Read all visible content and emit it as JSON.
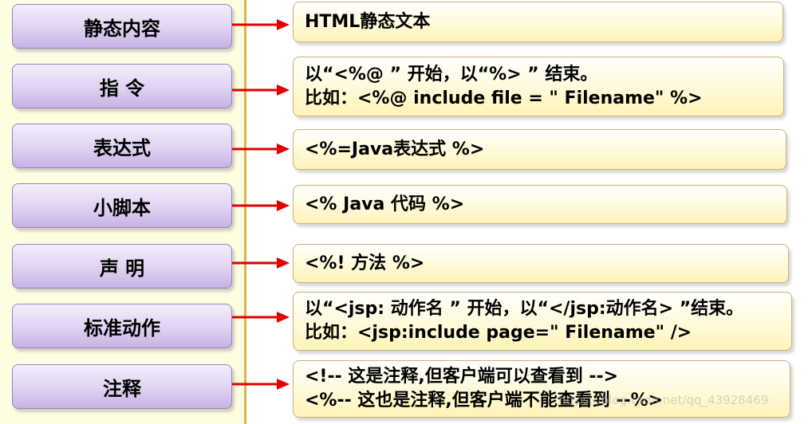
{
  "rows": [
    {
      "label": "静态内容",
      "lines": [
        "HTML静态文本"
      ]
    },
    {
      "label": "指 令",
      "lines": [
        "以“<%@ ” 开始，以“%> ” 结束。",
        "比如：<%@ include file = \" Filename\" %>"
      ]
    },
    {
      "label": "表达式",
      "lines": [
        "<%=Java表达式 %>"
      ]
    },
    {
      "label": "小脚本",
      "lines": [
        "<% Java 代码 %>"
      ]
    },
    {
      "label": "声 明",
      "lines": [
        "<%! 方法 %>"
      ]
    },
    {
      "label": "标准动作",
      "lines": [
        "以“<jsp: 动作名 ” 开始，以“</jsp:动作名> ”结束。",
        "比如：<jsp:include page=\" Filename\" />"
      ]
    },
    {
      "label": "注释",
      "lines": [
        "<!-- 这是注释,但客户端可以查看到 -->",
        "<%-- 这也是注释,但客户端不能查看到 --%>"
      ]
    }
  ],
  "watermark": "https://blog.csdn.net/qq_43928469",
  "colors": {
    "arrow": "#e00000",
    "left_fill": "#e0d2f1",
    "right_fill": "#fff3b8",
    "divider": "#d8b64a"
  }
}
